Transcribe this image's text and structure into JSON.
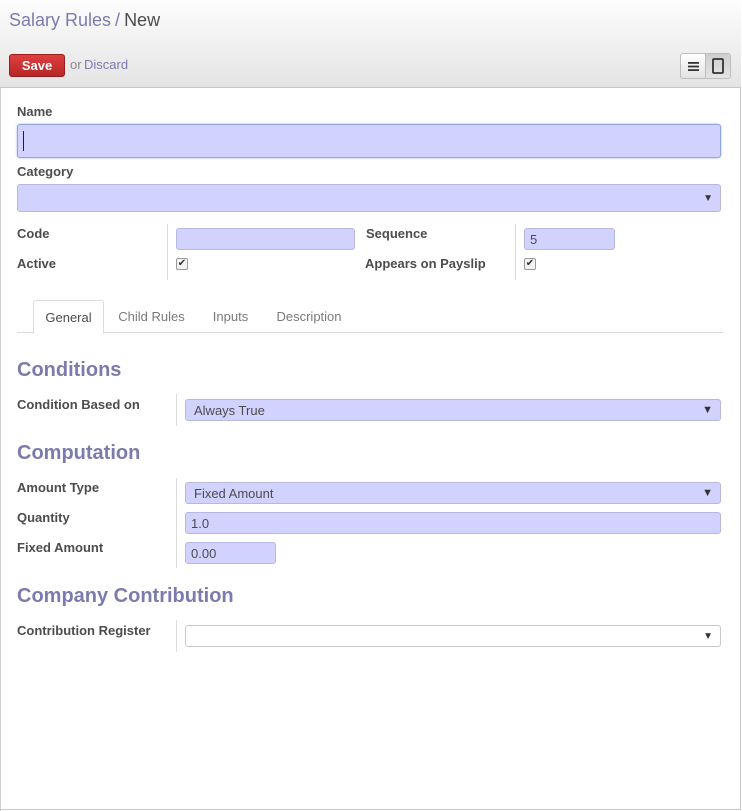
{
  "breadcrumb": {
    "parent": "Salary Rules",
    "separator": "/",
    "current": "New"
  },
  "toolbar": {
    "save_label": "Save",
    "or_text": "or",
    "discard_label": "Discard"
  },
  "form": {
    "name": {
      "label": "Name",
      "value": ""
    },
    "category": {
      "label": "Category",
      "value": ""
    },
    "code": {
      "label": "Code",
      "value": ""
    },
    "sequence": {
      "label": "Sequence",
      "value": "5"
    },
    "active": {
      "label": "Active",
      "checked": true
    },
    "appears_on_payslip": {
      "label": "Appears on Payslip",
      "checked": true
    }
  },
  "tabs": [
    {
      "label": "General",
      "active": true
    },
    {
      "label": "Child Rules",
      "active": false
    },
    {
      "label": "Inputs",
      "active": false
    },
    {
      "label": "Description",
      "active": false
    }
  ],
  "conditions": {
    "title": "Conditions",
    "condition_based_on": {
      "label": "Condition Based on",
      "value": "Always True"
    }
  },
  "computation": {
    "title": "Computation",
    "amount_type": {
      "label": "Amount Type",
      "value": "Fixed Amount"
    },
    "quantity": {
      "label": "Quantity",
      "value": "1.0"
    },
    "fixed_amount": {
      "label": "Fixed Amount",
      "value": "0.00"
    }
  },
  "company_contribution": {
    "title": "Company Contribution",
    "contribution_register": {
      "label": "Contribution Register",
      "value": ""
    }
  },
  "colors": {
    "accent": "#7c7bad",
    "save_button": "#c9302c",
    "field_bg": "#d2d2ff"
  },
  "icons": {
    "list_view": "list-view-icon",
    "form_view": "form-view-icon",
    "dropdown": "chevron-down-icon",
    "checkbox": "checkmark-icon"
  }
}
